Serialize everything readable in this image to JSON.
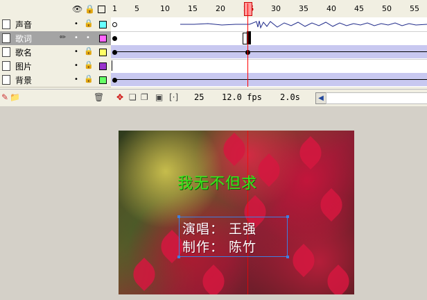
{
  "ruler": {
    "numbers": [
      "1",
      "5",
      "10",
      "15",
      "20",
      "25",
      "30",
      "35",
      "40",
      "45",
      "50",
      "55"
    ]
  },
  "layer_header": {
    "eye_icon": "eye-icon",
    "lock_icon": "lock-icon",
    "outline_icon": "outline-square-icon"
  },
  "layers": [
    {
      "name": "声音",
      "color": "#66ffff",
      "selected": false
    },
    {
      "name": "歌词",
      "color": "#ff66ff",
      "selected": true
    },
    {
      "name": "歌名",
      "color": "#ffff66",
      "selected": false
    },
    {
      "name": "图片",
      "color": "#9933cc",
      "selected": false
    },
    {
      "name": "背景",
      "color": "#66ff66",
      "selected": false
    }
  ],
  "timeline_bar": {
    "current_frame": "25",
    "fps": "12.0 fps",
    "time": "2.0s"
  },
  "stage": {
    "song_title": "我无不但求",
    "credit_singer": "演唱： 王强",
    "credit_producer": "制作： 陈竹"
  },
  "colors": {
    "playhead": "#ff0000",
    "selection": "#3f7fe0",
    "title_green": "#39e61c"
  }
}
